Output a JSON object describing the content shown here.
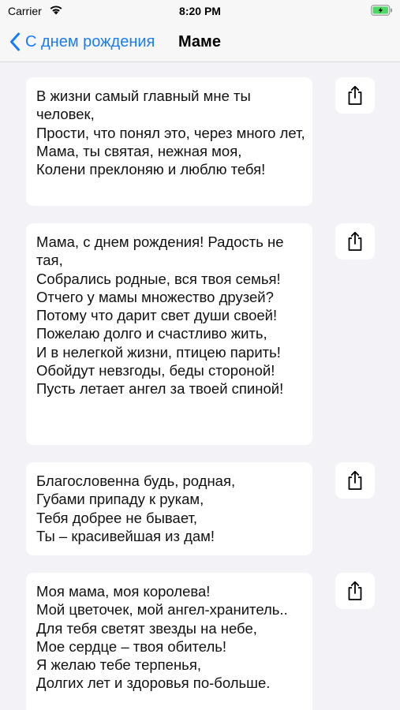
{
  "status_bar": {
    "carrier": "Carrier",
    "time": "8:20 PM",
    "wifi_icon": "wifi-icon",
    "battery_icon": "battery-charging-icon",
    "battery_color": "#4cd964"
  },
  "nav": {
    "back_label": "С днем рождения",
    "title": "Маме",
    "accent_color": "#1a7cf5"
  },
  "poems": [
    {
      "text": "В жизни самый главный мне ты человек,\nПрости, что понял это, через много лет,\nМама, ты святая, нежная моя,\nКолени преклоняю и люблю тебя!",
      "share_icon": "share-icon"
    },
    {
      "text": "Мама, с днем рождения! Радость не тая,\nСобрались родные, вся твоя семья!\nОтчего у мамы множество друзей?\nПотому что дарит свет души своей!\nПожелаю долго и счастливо жить,\nИ в нелегкой жизни, птицею парить!\nОбойдут невзгоды, беды стороной!\nПусть летает ангел за твоей спиной!",
      "share_icon": "share-icon"
    },
    {
      "text": "Благословенна будь, родная,\nГубами припаду к рукам,\nТебя добрее не бывает,\nТы – красивейшая из дам!",
      "share_icon": "share-icon"
    },
    {
      "text": "Моя мама, моя королева!\nМой цветочек, мой ангел-хранитель..\nДля тебя светят звезды на небе,\nМое сердце – твоя обитель!\nЯ желаю тебе терпенья,\nДолгих лет и здоровья по-больше.",
      "share_icon": "share-icon"
    }
  ]
}
